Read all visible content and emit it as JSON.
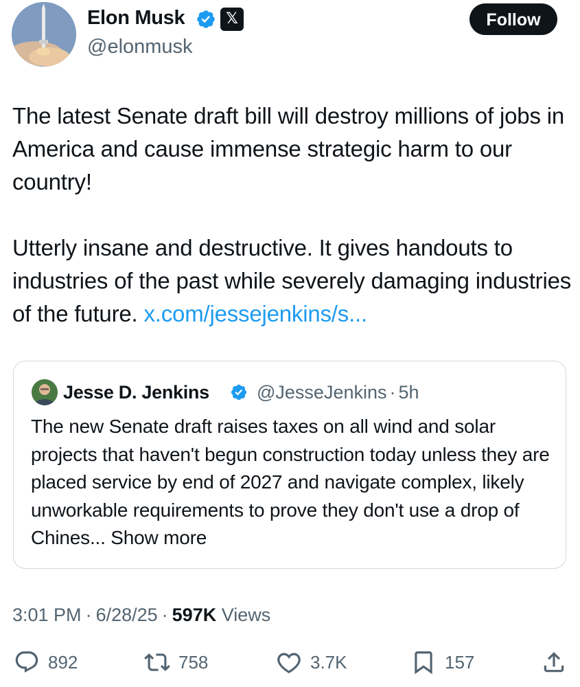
{
  "author": {
    "name": "Elon Musk",
    "handle": "@elonmusk",
    "verified_badge_icon": "verified-badge-icon",
    "affiliate_badge_icon": "x-logo-icon"
  },
  "follow_label": "Follow",
  "tweet": {
    "paragraph1": "The latest Senate draft bill will destroy millions of jobs in America and cause immense strategic harm to our country!",
    "paragraph2": "Utterly insane and destructive. It gives handouts to industries of the past while severely damaging industries of the future.",
    "link_text": "x.com/jessejenkins/s..."
  },
  "quote": {
    "name": "Jesse D. Jenkins",
    "handle": "@JesseJenkins",
    "separator": "·",
    "age": "5h",
    "text": "The new Senate draft raises taxes on all wind and solar projects that haven't begun construction today unless they are placed service by end of 2027 and navigate complex, likely unworkable requirements to prove they don't use a drop of Chines...",
    "show_more": "Show more"
  },
  "meta": {
    "time": "3:01 PM",
    "date": "6/28/25",
    "separator": "·",
    "views_count": "597K",
    "views_label": "Views"
  },
  "actions": {
    "replies": "892",
    "reposts": "758",
    "likes": "3.7K",
    "bookmarks": "157"
  },
  "colors": {
    "text": "#0f1419",
    "secondary": "#536471",
    "link": "#1d9bf0",
    "border": "#cfd9de",
    "button_bg": "#0f1419"
  }
}
